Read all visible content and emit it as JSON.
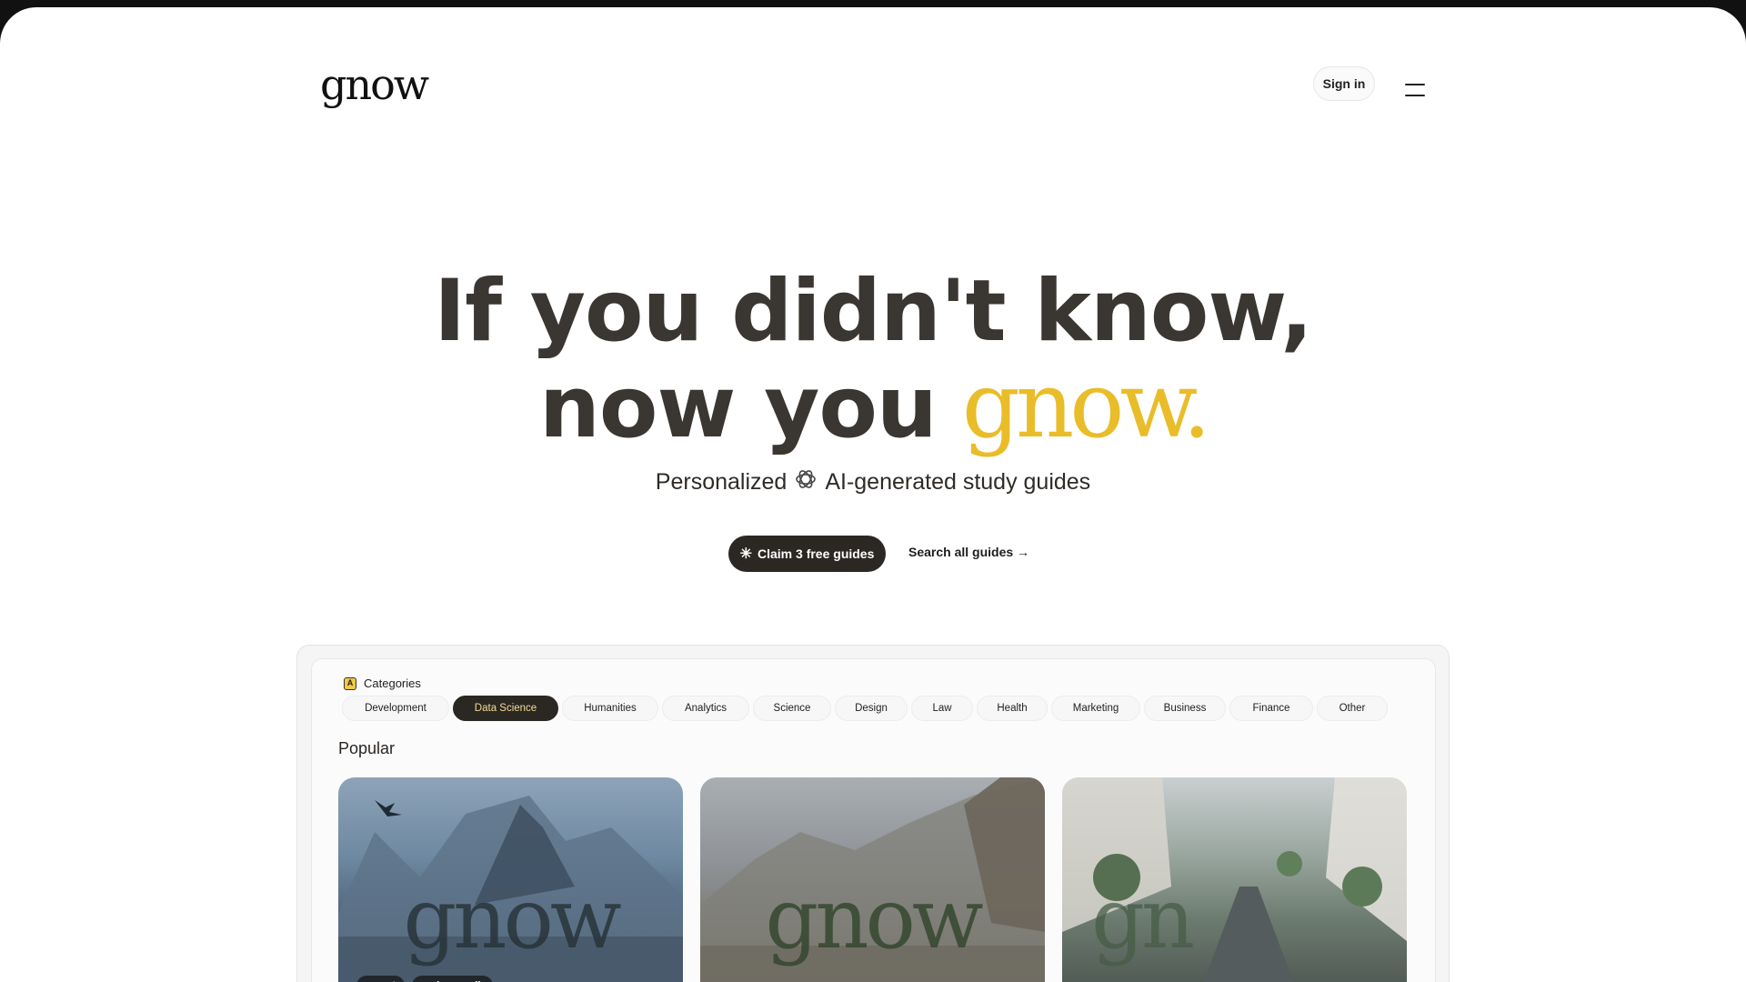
{
  "brand": {
    "logo_text": "gnow"
  },
  "header": {
    "signin_label": "Sign in"
  },
  "hero": {
    "line1": "If you didn't know,",
    "line2_prefix": "now you",
    "line2_accent": "gnow.",
    "subtitle_before": "Personalized",
    "subtitle_after": "AI-generated study guides",
    "subtitle_icon": "openai-icon",
    "cta_label": "Claim 3 free guides",
    "cta_icon": "sparkle-icon",
    "search_link_label": "Search all guides →"
  },
  "categories": {
    "title": "Categories",
    "items": [
      {
        "label": "Development",
        "active": false
      },
      {
        "label": "Data Science",
        "active": true
      },
      {
        "label": "Humanities",
        "active": false
      },
      {
        "label": "Analytics",
        "active": false
      },
      {
        "label": "Science",
        "active": false
      },
      {
        "label": "Design",
        "active": false
      },
      {
        "label": "Law",
        "active": false
      },
      {
        "label": "Health",
        "active": false
      },
      {
        "label": "Marketing",
        "active": false
      },
      {
        "label": "Business",
        "active": false
      },
      {
        "label": "Finance",
        "active": false
      },
      {
        "label": "Other",
        "active": false
      }
    ]
  },
  "popular": {
    "title": "Popular",
    "cards": [
      {
        "image_word": "gnow",
        "tags": [
          {
            "label": "expert"
          },
          {
            "label": "dynamodb",
            "icon": "tag-icon"
          }
        ]
      },
      {
        "image_word": "gnow",
        "tags": []
      },
      {
        "image_word": "gn",
        "tags": []
      }
    ]
  },
  "colors": {
    "accent": "#e9bd29",
    "dark": "#2b2824",
    "text": "#3a3631"
  }
}
